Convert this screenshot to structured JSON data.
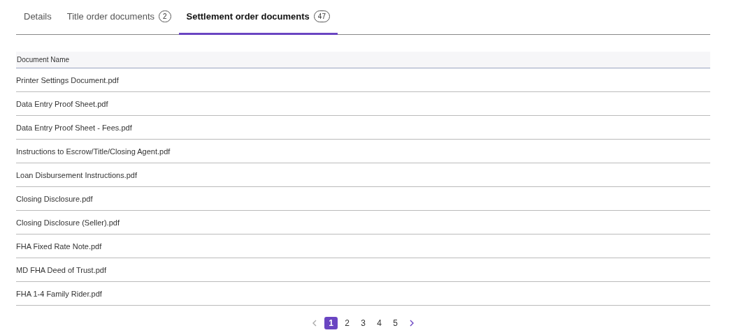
{
  "tabs": [
    {
      "label": "Details",
      "selected": false
    },
    {
      "label": "Title order documents",
      "count": "2",
      "selected": false
    },
    {
      "label": "Settlement order documents",
      "count": "47",
      "selected": true
    }
  ],
  "table": {
    "columns": [
      "Document Name"
    ],
    "rows": [
      "Printer Settings Document.pdf",
      "Data Entry Proof Sheet.pdf",
      "Data Entry Proof Sheet - Fees.pdf",
      "Instructions to Escrow/Title/Closing Agent.pdf",
      "Loan Disbursement Instructions.pdf",
      "Closing Disclosure.pdf",
      "Closing Disclosure (Seller).pdf",
      "FHA Fixed Rate Note.pdf",
      "MD FHA Deed of Trust.pdf",
      "FHA 1-4 Family Rider.pdf"
    ]
  },
  "pagination": {
    "prev_disabled": true,
    "next_disabled": false,
    "pages": [
      {
        "label": "1",
        "selected": true
      },
      {
        "label": "2",
        "selected": false
      },
      {
        "label": "3",
        "selected": false
      },
      {
        "label": "4",
        "selected": false
      },
      {
        "label": "5",
        "selected": false
      }
    ]
  }
}
